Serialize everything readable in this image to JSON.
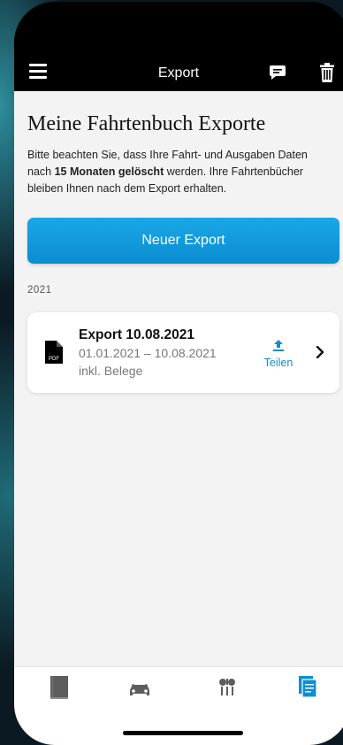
{
  "header": {
    "title": "Export"
  },
  "page": {
    "title": "Meine Fahrtenbuch Exporte",
    "intro_part1": "Bitte beachten Sie, dass Ihre Fahrt- und Ausgaben Daten nach ",
    "intro_bold": "15 Monaten gelöscht",
    "intro_part2": " werden. Ihre Fahrtenbücher bleiben Ihnen nach dem Export erhalten.",
    "new_export_label": "Neuer Export"
  },
  "exports": {
    "year": "2021",
    "items": [
      {
        "title": "Export 10.08.2021",
        "range": "01.01.2021 – 10.08.2021",
        "note": "inkl. Belege",
        "file_badge": "PDF",
        "share_label": "Teilen"
      }
    ]
  },
  "tabbar": {
    "tabs": [
      "logbook-icon",
      "car-icon",
      "expenses-icon",
      "export-icon"
    ],
    "active": "export-icon"
  },
  "colors": {
    "accent": "#0d8ed1",
    "header": "#000000",
    "background": "#f3f3f3"
  }
}
